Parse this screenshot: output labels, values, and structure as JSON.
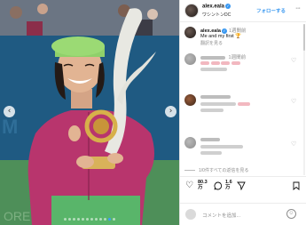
{
  "post": {
    "username": "alex.eala",
    "location": "ワシントンDC",
    "follow_label": "フォローする",
    "more_label": "···"
  },
  "carousel": {
    "prev_label": "‹",
    "next_label": "›",
    "dot_count": 12,
    "active_dot": 10
  },
  "caption": {
    "username": "alex.eala",
    "time": "1週間前",
    "text": "Me and my first 🏆",
    "translate_label": "翻訳を見る"
  },
  "comments": [
    {
      "time": "1週間前",
      "likes_label": "",
      "reply_label": ""
    },
    {
      "time": "",
      "likes_label": "",
      "reply_label": ""
    },
    {
      "time": "",
      "likes_label": "",
      "reply_label": ""
    },
    {
      "time": "",
      "likes_label": "",
      "reply_label": ""
    }
  ],
  "view_all_label": "1/0件すべての返信を見る",
  "actions": {
    "like_icon": "heart-icon",
    "likes_count_top": "80.3",
    "likes_count_bottom": "万",
    "comment_icon": "speech-bubble-icon",
    "comments_count_top": "1.6",
    "comments_count_bottom": "万",
    "share_icon": "paper-plane-icon",
    "save_icon": "bookmark-icon"
  },
  "composer": {
    "placeholder": "コメントを追加...",
    "emoji_icon": "smiley-icon"
  },
  "colors": {
    "accent": "#3897f0",
    "jacket": "#b8356d",
    "cap": "#8fd06a"
  }
}
